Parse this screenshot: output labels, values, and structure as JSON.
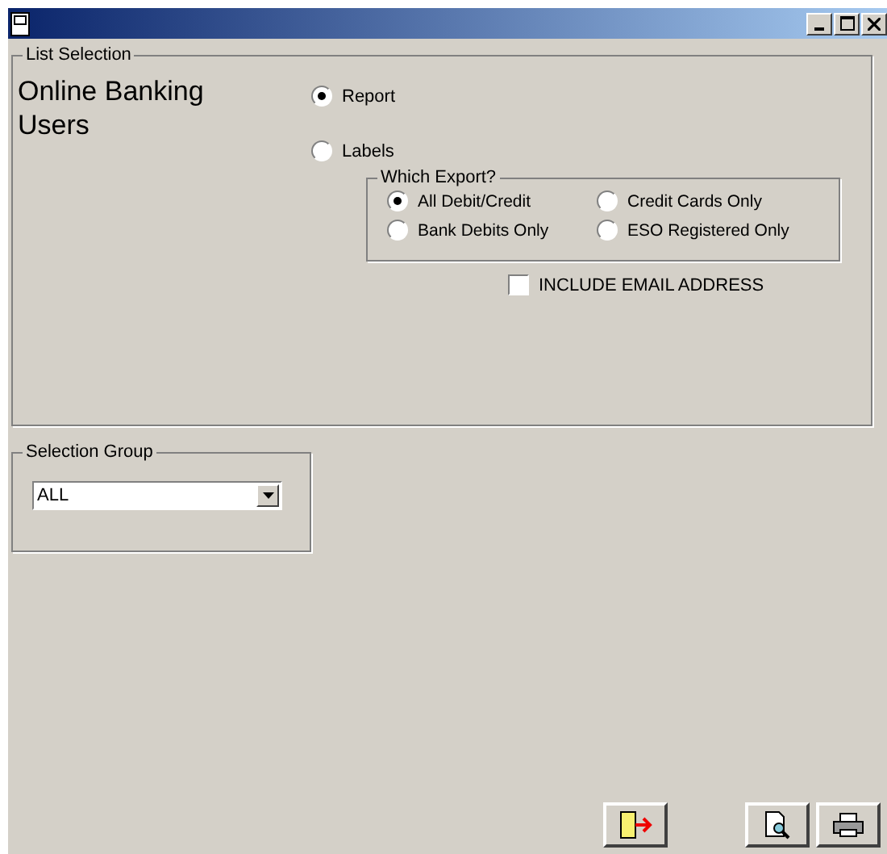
{
  "list_selection": {
    "legend": "List Selection",
    "title": "Online Banking Users",
    "output_options": [
      {
        "label": "Report",
        "selected": true
      },
      {
        "label": "Labels",
        "selected": false
      }
    ],
    "which_export": {
      "legend": "Which Export?",
      "options": [
        {
          "label": "All Debit/Credit",
          "selected": true
        },
        {
          "label": "Credit Cards Only",
          "selected": false
        },
        {
          "label": "Bank Debits Only",
          "selected": false
        },
        {
          "label": "ESO Registered Only",
          "selected": false
        }
      ]
    },
    "include_email": {
      "label": "INCLUDE EMAIL ADDRESS",
      "checked": false
    }
  },
  "selection_group": {
    "legend": "Selection Group",
    "value": "ALL"
  }
}
